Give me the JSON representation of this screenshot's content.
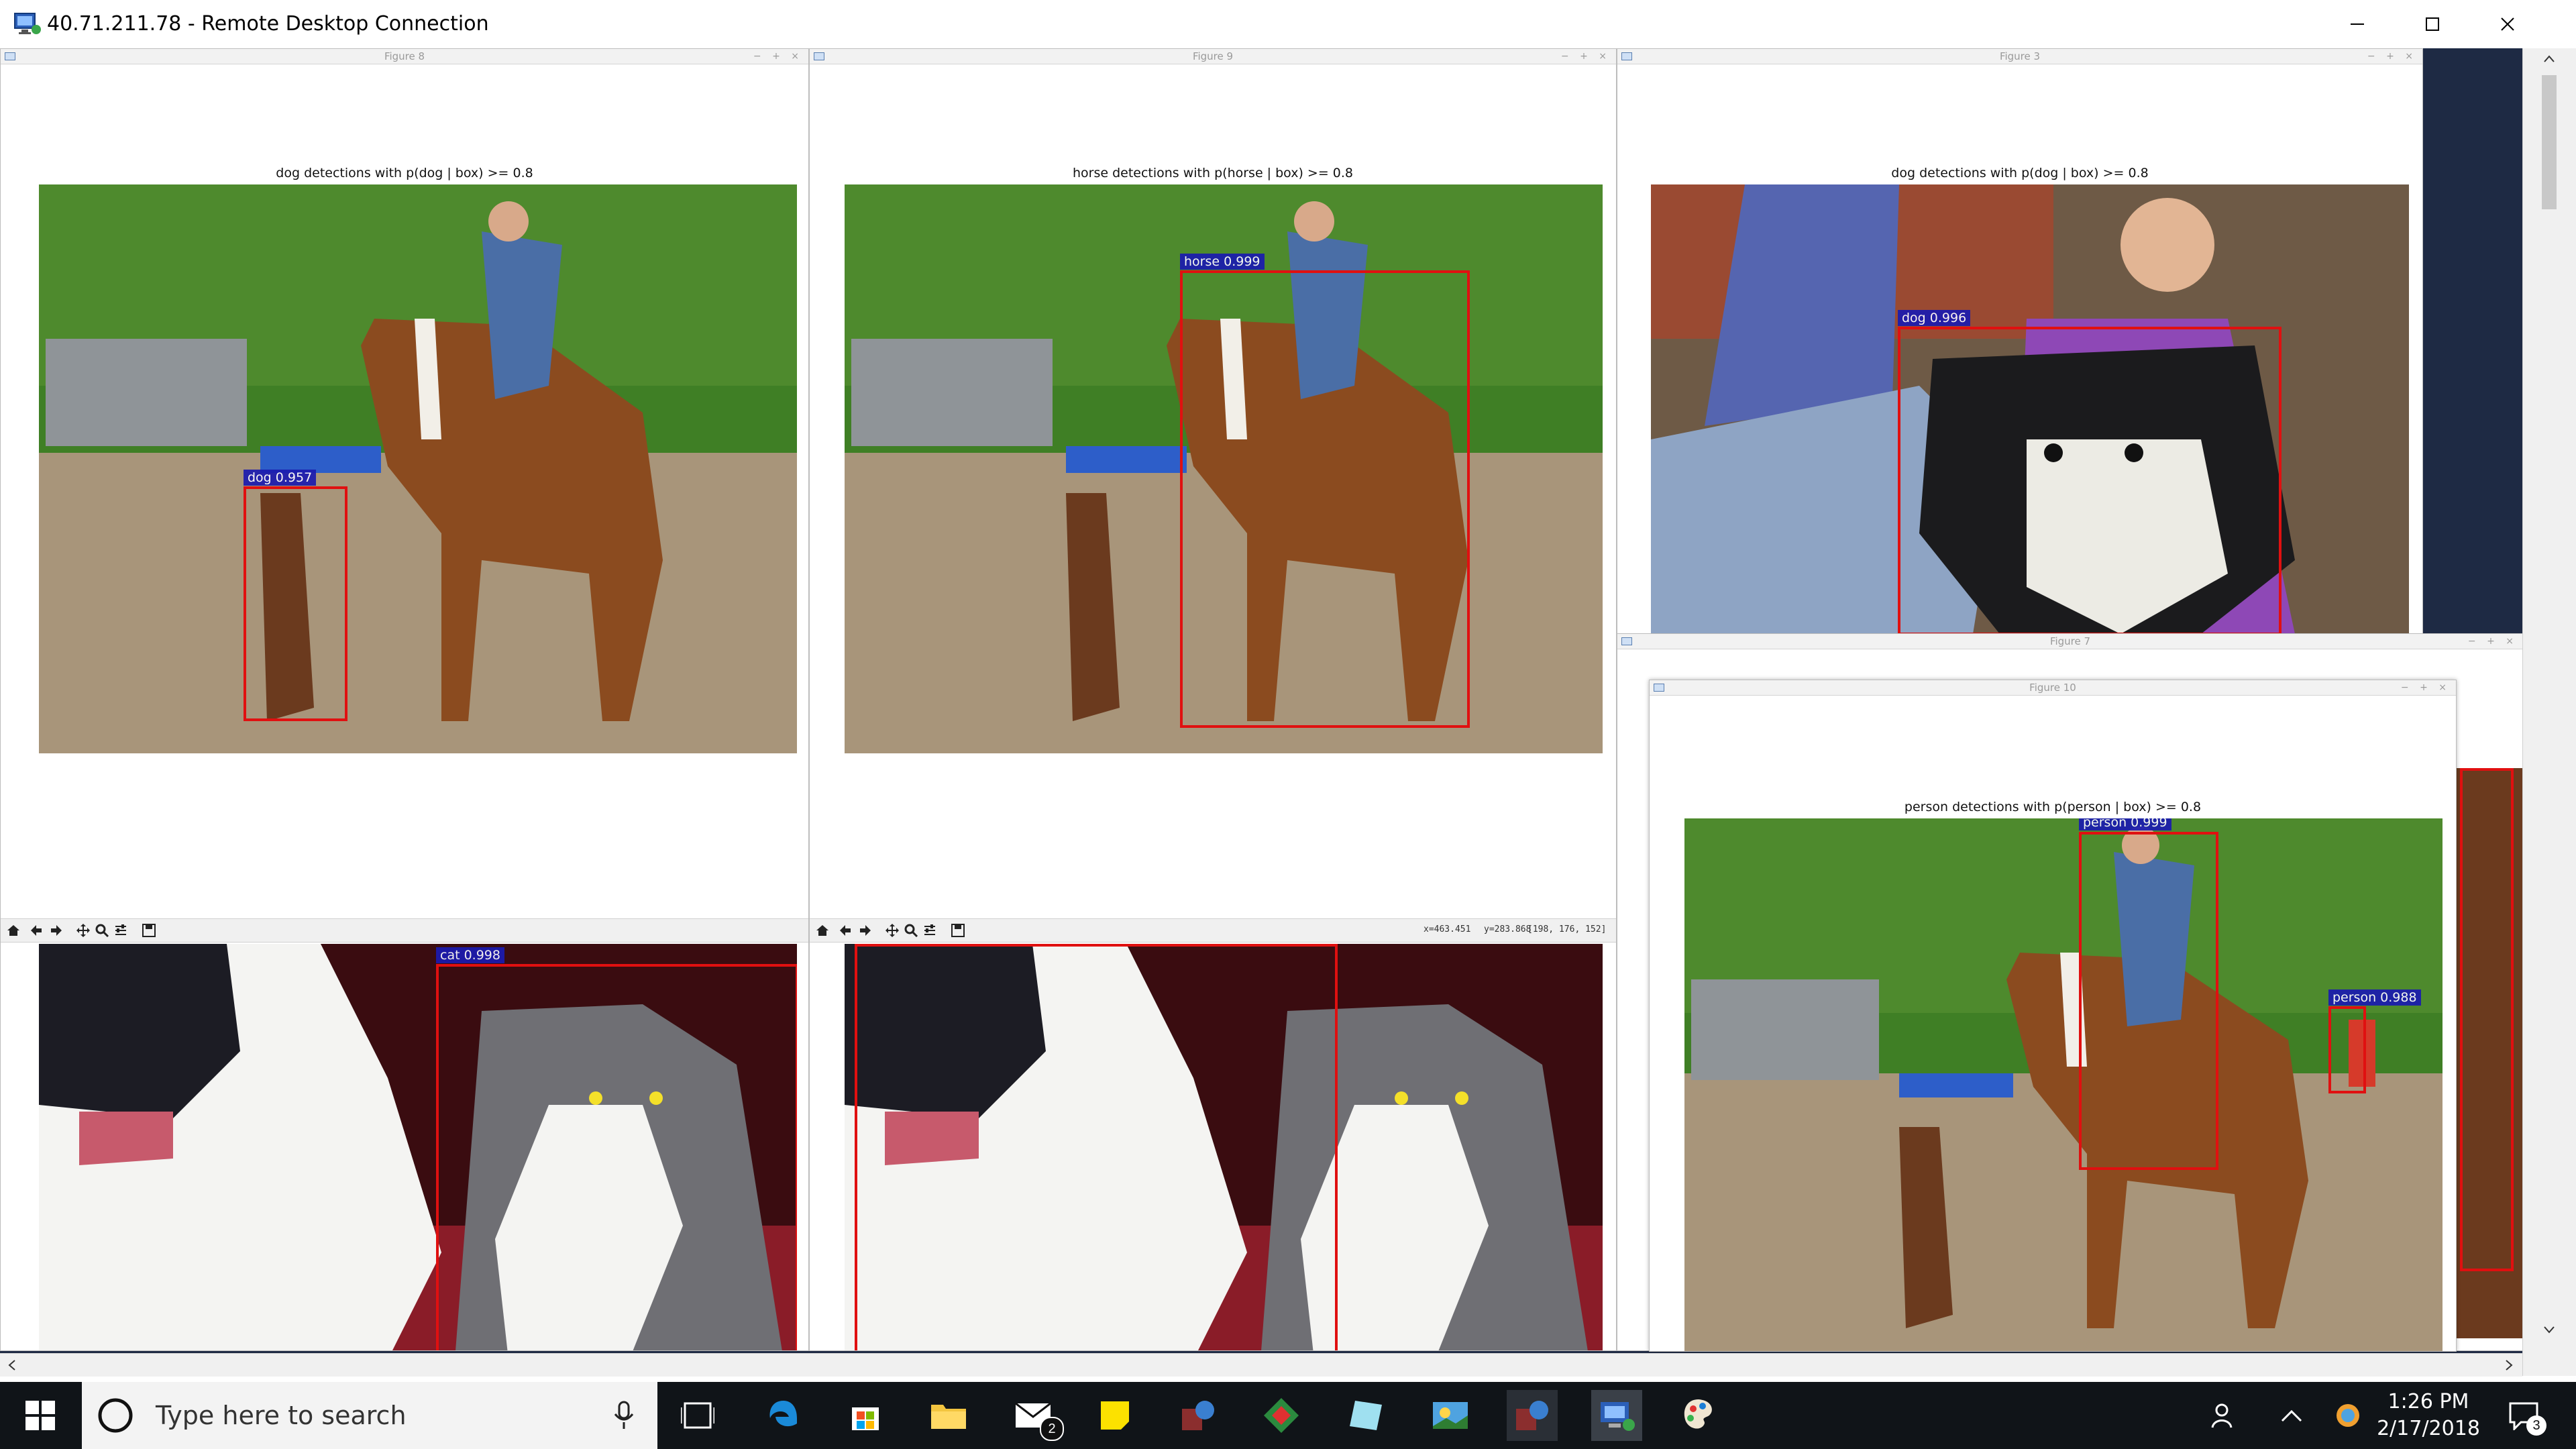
{
  "window": {
    "title": "40.71.211.78 - Remote Desktop Connection",
    "controls": [
      "minimize-icon",
      "maximize-icon",
      "close-icon"
    ]
  },
  "figures": [
    {
      "window_title": "Figure 8",
      "plot_title": "dog detections with p(dog | box) >= 0.8",
      "detection": "dog 0.957"
    },
    {
      "window_title": "Figure 9",
      "plot_title": "horse detections with p(horse | box) >= 0.8",
      "detection": "horse 0.999"
    },
    {
      "window_title": "Figure 3",
      "plot_title": "dog detections with p(dog | box) >= 0.8",
      "detection": "dog 0.996"
    },
    {
      "window_title": "Figure 7"
    },
    {
      "window_title": "Figure 10",
      "plot_title": "person detections with p(person | box) >= 0.8",
      "detections": [
        "person 0.999",
        "person 0.988"
      ]
    }
  ],
  "cat_figure": {
    "detection": "cat 0.998"
  },
  "toolbar": {
    "icons": [
      "home-icon",
      "back-icon",
      "forward-icon",
      "pan-icon",
      "zoom-icon",
      "configure-icon",
      "save-icon"
    ],
    "readout_x": "x=463.451",
    "readout_y": "y=283.868",
    "readout_rgb": "[198, 176, 152]"
  },
  "taskbar": {
    "search_placeholder": "Type here to search",
    "mail_badge": "2",
    "time": "1:26 PM",
    "date": "2/17/2018",
    "notification_count": "3",
    "apps": [
      "start-icon",
      "cortana-icon",
      "microphone-icon",
      "task-view-icon",
      "edge-icon",
      "store-icon",
      "file-explorer-icon",
      "mail-icon",
      "sticky-notes-icon",
      "winrar-icon",
      "app-icon",
      "color-icon",
      "photos-icon",
      "winrar-icon",
      "remote-desktop-icon",
      "paint-icon"
    ]
  },
  "colors": {
    "detection_box": "#e01010",
    "detection_label_bg": "#1b1bb0",
    "taskbar": "#101418",
    "desktop": "#1e2a44"
  }
}
